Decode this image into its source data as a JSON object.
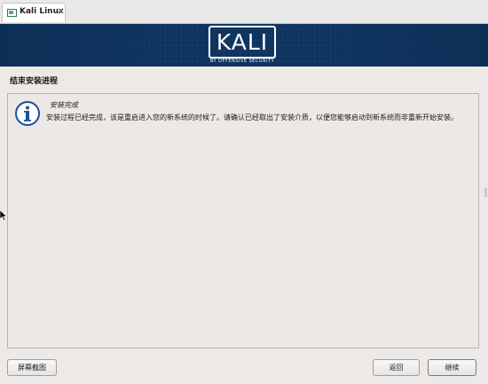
{
  "browser": {
    "tab_title": "Kali Linux",
    "tab_close": "×"
  },
  "banner": {
    "logo_text": "KALI",
    "logo_subtitle": "BY OFFENSIVE SECURITY"
  },
  "page": {
    "title": "结束安装进程"
  },
  "message": {
    "icon": "info-icon",
    "title": "安装完成",
    "body": "安装过程已经完成，该是重启进入您的新系统的时候了。请确认已经取出了安装介质，以便您能够启动到新系统而非重新开始安装。"
  },
  "buttons": {
    "screenshot": "屏幕截图",
    "back": "返回",
    "continue": "继续"
  },
  "colors": {
    "banner_bg": "#0d2f57",
    "content_bg": "#ece9e6",
    "info_icon": "#1c4e9d"
  }
}
